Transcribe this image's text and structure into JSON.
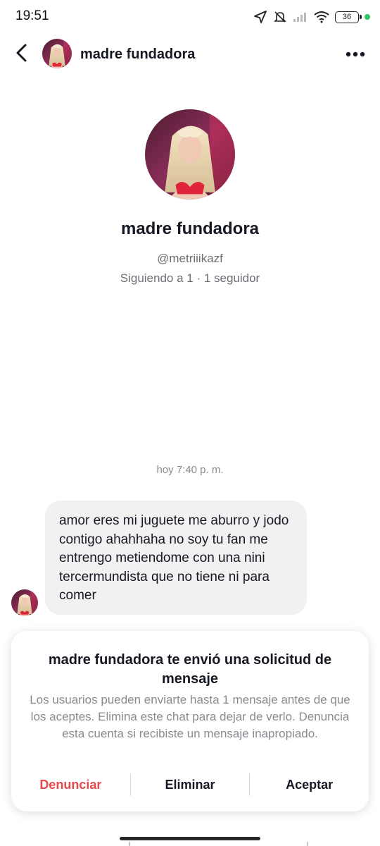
{
  "status_bar": {
    "time": "19:51",
    "battery": "36",
    "icons": [
      "location-arrow-icon",
      "bell-muted-icon",
      "signal-icon",
      "wifi-icon",
      "battery-icon",
      "privacy-dot-icon"
    ]
  },
  "header": {
    "back_icon": "chevron-left-icon",
    "name": "madre fundadora",
    "more_icon": "more-horizontal-icon"
  },
  "profile": {
    "name": "madre fundadora",
    "handle": "@metriiikazf",
    "stats": "Siguiendo a 1 · 1 seguidor"
  },
  "chat": {
    "timestamp": "hoy 7:40 p. m.",
    "message": "amor eres mi juguete me aburro y jodo contigo ahahhaha no soy tu fan me entrengo metiendome con una nini tercermundista que no tiene ni para comer"
  },
  "request": {
    "title": "madre fundadora te envió una solicitud de mensaje",
    "body": "Los usuarios pueden enviarte hasta 1 mensaje antes de que los aceptes. Elimina este chat para dejar de verlo. Denuncia esta cuenta si recibiste un mensaje inapropiado.",
    "actions": {
      "report": "Denunciar",
      "delete": "Eliminar",
      "accept": "Aceptar"
    }
  },
  "colors": {
    "report": "#e5484d",
    "bubble": "#f1f1f2",
    "secondary_text": "#8a8b91"
  }
}
